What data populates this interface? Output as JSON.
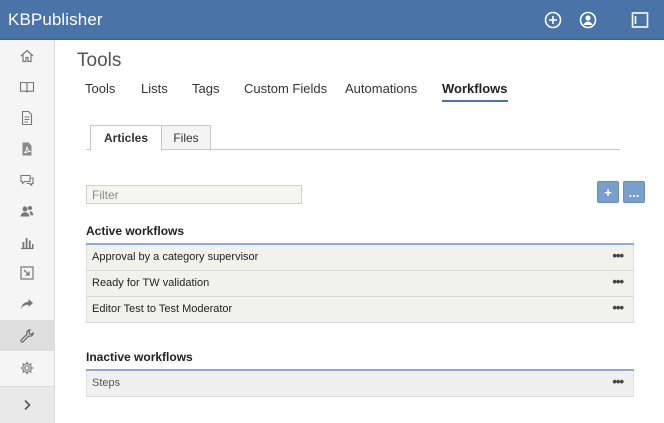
{
  "app": {
    "brand": "KBPublisher",
    "top_icons": [
      "plus-circle-icon",
      "user-circle-icon",
      "window-icon"
    ]
  },
  "sidebar": {
    "items": [
      {
        "icon": "home-icon"
      },
      {
        "icon": "book-icon"
      },
      {
        "icon": "document-icon"
      },
      {
        "icon": "pdf-file-icon"
      },
      {
        "icon": "chat-icon"
      },
      {
        "icon": "users-icon"
      },
      {
        "icon": "bar-chart-icon"
      },
      {
        "icon": "import-icon"
      },
      {
        "icon": "share-arrow-icon"
      },
      {
        "icon": "wrench-icon",
        "active": true
      },
      {
        "icon": "gear-icon"
      },
      {
        "icon": "chevron-right-icon"
      }
    ]
  },
  "page": {
    "title": "Tools",
    "tabs": [
      {
        "label": "Tools"
      },
      {
        "label": "Lists"
      },
      {
        "label": "Tags"
      },
      {
        "label": "Custom Fields"
      },
      {
        "label": "Automations"
      },
      {
        "label": "Workflows",
        "active": true
      }
    ],
    "sub_tabs": [
      {
        "label": "Articles",
        "active": true
      },
      {
        "label": "Files"
      }
    ],
    "filter_placeholder": "Filter",
    "add_label": "+",
    "more_label": "..."
  },
  "active_workflows": {
    "title": "Active workflows",
    "items": [
      {
        "label": "Approval by a category supervisor",
        "menu": "•••"
      },
      {
        "label": "Ready for TW validation",
        "menu": "•••"
      },
      {
        "label": "Editor Test to Test Moderator",
        "menu": "•••"
      }
    ]
  },
  "inactive_workflows": {
    "title": "Inactive workflows",
    "items": [
      {
        "label": "Steps",
        "menu": "•••"
      }
    ]
  },
  "colors": {
    "topbar": "#4a73a8",
    "accent": "#7b9fcc",
    "sidebar": "#f5f5f5"
  }
}
